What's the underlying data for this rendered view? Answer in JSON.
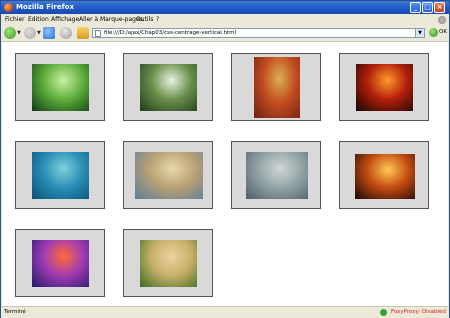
{
  "window": {
    "title": "Mozilla Firefox"
  },
  "menu": [
    {
      "label": "Fichier"
    },
    {
      "label": "Edition"
    },
    {
      "label": "Affichage"
    },
    {
      "label": "Aller à"
    },
    {
      "label": "Marque-pages"
    },
    {
      "label": "Outils"
    },
    {
      "label": "?"
    }
  ],
  "navbar": {
    "url": "file:///D:/ajax/Chap03/css-centrage-vertical.html",
    "go_label": "OK"
  },
  "gallery": {
    "images": [
      {
        "name": "forest",
        "colors": [
          "#0d3a12",
          "#5fae3c",
          "#c9f2a3"
        ]
      },
      {
        "name": "waterfall",
        "colors": [
          "#1f3a1c",
          "#6a8f4a",
          "#e6f2e2"
        ]
      },
      {
        "name": "coral-reef",
        "colors": [
          "#6b1f13",
          "#c34d21",
          "#d7b050"
        ]
      },
      {
        "name": "volcano",
        "colors": [
          "#120505",
          "#b21e0a",
          "#ff9b2a"
        ]
      },
      {
        "name": "underwater-reef",
        "colors": [
          "#0a4f74",
          "#2a8fb6",
          "#7fd2d9"
        ]
      },
      {
        "name": "beach-huts",
        "colors": [
          "#5b7c9c",
          "#b7a074",
          "#e9d9a7"
        ]
      },
      {
        "name": "cloudy-lake",
        "colors": [
          "#4d5d6a",
          "#93a4a7",
          "#cfd6d4"
        ]
      },
      {
        "name": "cactus-sunset",
        "colors": [
          "#160604",
          "#c24a12",
          "#ffca54"
        ]
      },
      {
        "name": "purple-sunset",
        "colors": [
          "#1e1b6b",
          "#a13bb3",
          "#ff6a3a"
        ]
      },
      {
        "name": "village-hill",
        "colors": [
          "#3b6a1f",
          "#c7b06a",
          "#e8d3a2"
        ]
      }
    ]
  },
  "status": {
    "text": "Terminé",
    "proxy": "FoxyProxy: Disabled"
  }
}
